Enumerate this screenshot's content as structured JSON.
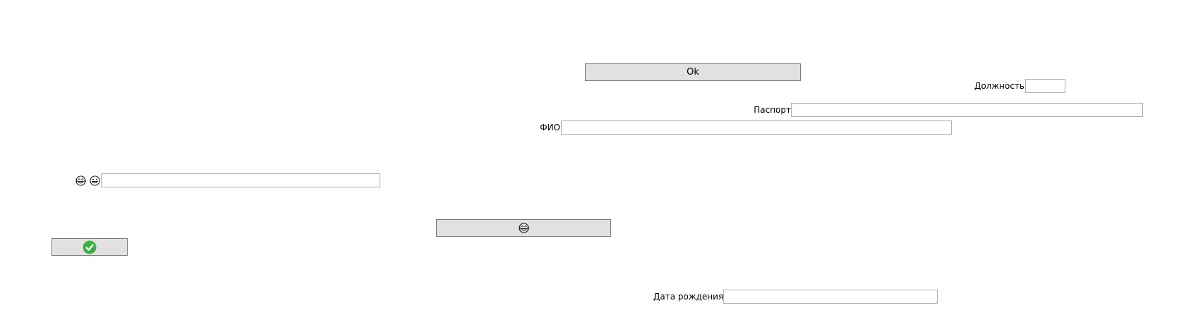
{
  "buttons": {
    "ok_label": "Ok",
    "laugh_icon": "face-with-tears-of-joy-icon",
    "check_icon": "green-checkmark-icon"
  },
  "fields": {
    "position_label": "Должность",
    "passport_label": "Паспорт",
    "fio_label": "ФИО",
    "birthdate_label": "Дата рождения",
    "position_value": "",
    "passport_value": "",
    "fio_value": "",
    "birthdate_value": "",
    "emoji_value": ""
  },
  "emoji_row": {
    "icons": [
      "face-with-tears-of-joy-icon",
      "grinning-face-icon"
    ]
  },
  "colors": {
    "check_green": "#3cb043",
    "button_face": "#e1e1e1",
    "button_border": "#7a7a7a",
    "field_border": "#abadb3"
  }
}
